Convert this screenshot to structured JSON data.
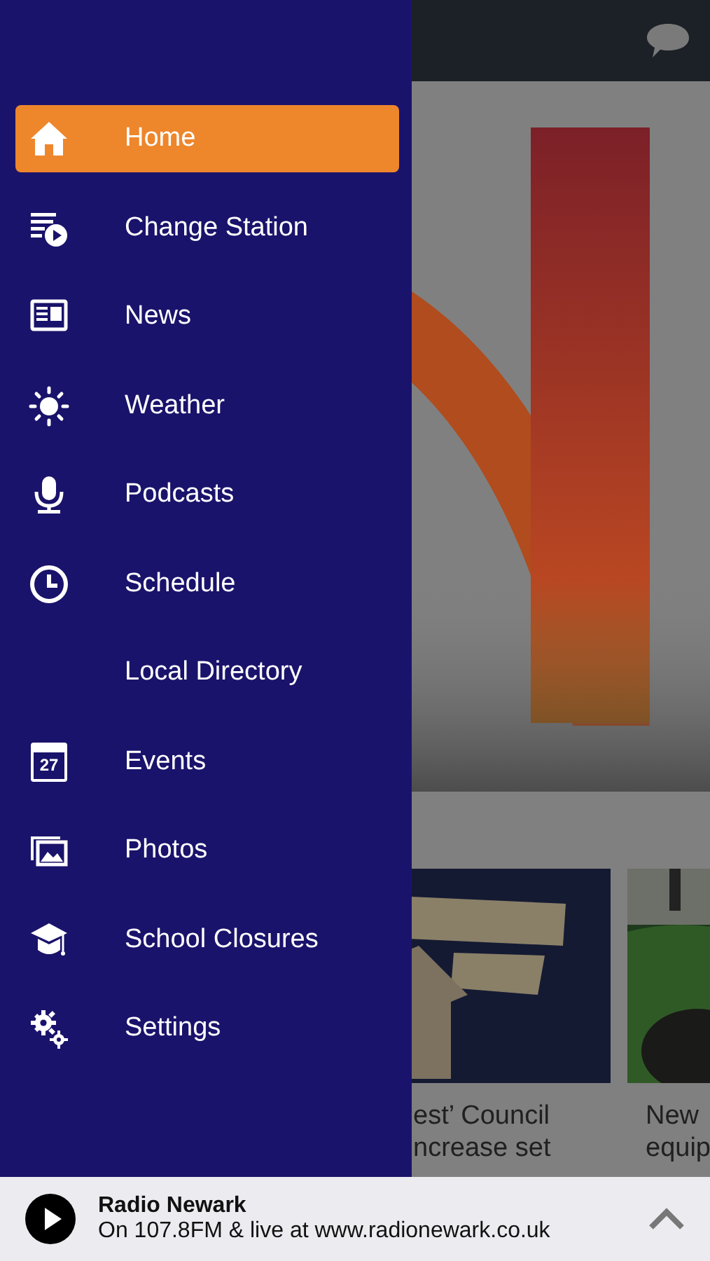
{
  "menu": [
    {
      "label": "Home",
      "kind": "home",
      "selected": true
    },
    {
      "label": "Change Station",
      "kind": "playlist",
      "selected": false
    },
    {
      "label": "News",
      "kind": "newspaper",
      "selected": false
    },
    {
      "label": "Weather",
      "kind": "sun",
      "selected": false
    },
    {
      "label": "Podcasts",
      "kind": "microphone",
      "selected": false
    },
    {
      "label": "Schedule",
      "kind": "clock",
      "selected": false
    },
    {
      "label": "Local Directory",
      "kind": "plain",
      "selected": false
    },
    {
      "label": "Events",
      "kind": "calendar",
      "icon_label": "27",
      "selected": false
    },
    {
      "label": "Photos",
      "kind": "photos",
      "selected": false
    },
    {
      "label": "School Closures",
      "kind": "cap",
      "selected": false
    },
    {
      "label": "Settings",
      "kind": "gears",
      "selected": false
    }
  ],
  "news_cards": [
    {
      "kind": "picture",
      "caption_lines": [
        "est’ Council",
        "ncrease set"
      ]
    },
    {
      "kind": "picture",
      "caption_lines": [
        "New",
        "equip"
      ]
    }
  ],
  "player": {
    "title": "Radio Newark",
    "subtitle": "On 107.8FM & live at www.radionewark.co.uk"
  }
}
